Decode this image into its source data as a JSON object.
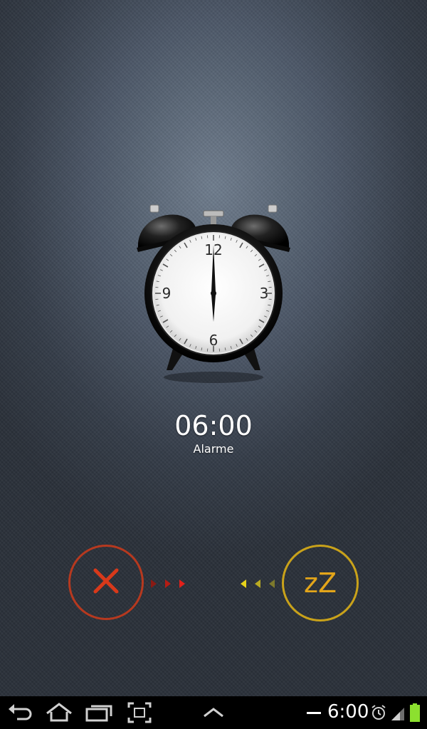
{
  "alarm": {
    "time": "06:00",
    "label": "Alarme"
  },
  "clock_face": {
    "numbers": {
      "n12": "12",
      "n3": "3",
      "n6": "6",
      "n9": "9"
    },
    "hands_time": "06:00"
  },
  "actions": {
    "dismiss_icon": "close-x-icon",
    "snooze_label": "zZ",
    "colors": {
      "dismiss": "#c23a1e",
      "snooze": "#d4a11c"
    }
  },
  "navbar": {
    "buttons": [
      "back-icon",
      "home-icon",
      "recent-apps-icon",
      "screenshot-icon",
      "chevron-up-icon"
    ]
  },
  "status_bar": {
    "time": "6:00",
    "icons": [
      "minus-icon",
      "alarm-clock-icon",
      "signal-icon",
      "battery-icon"
    ],
    "battery_color": "#8ce02f"
  }
}
